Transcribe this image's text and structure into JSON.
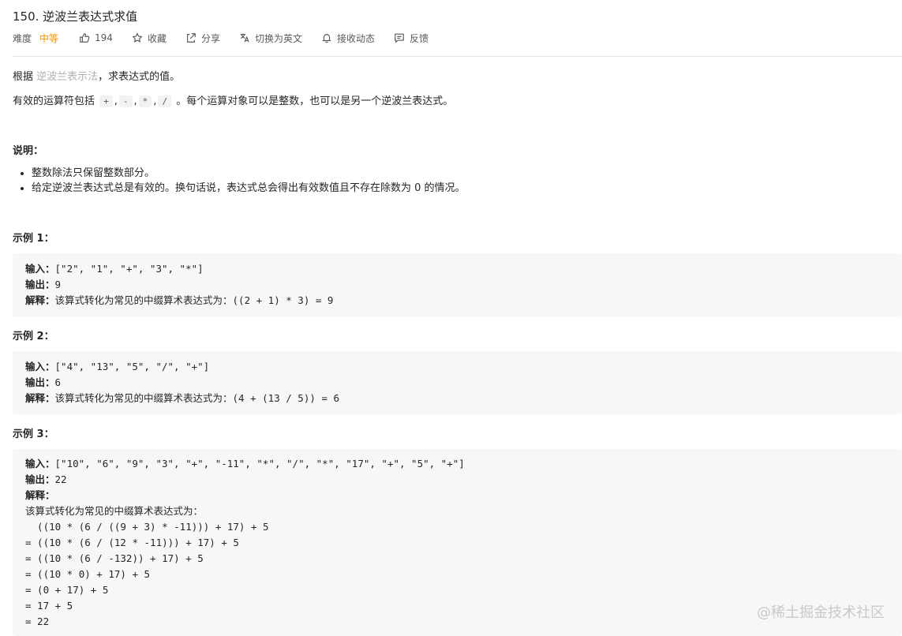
{
  "problem": {
    "title": "150. 逆波兰表达式求值"
  },
  "meta": {
    "difficulty_label": "难度",
    "difficulty": "中等",
    "likes": "194",
    "favorite": "收藏",
    "share": "分享",
    "switch_lang": "切换为英文",
    "notify": "接收动态",
    "feedback": "反馈"
  },
  "desc": {
    "p1_pre": "根据 ",
    "p1_link": "逆波兰表示法",
    "p1_post": "，求表达式的值。",
    "p2_pre": "有效的运算符包括 ",
    "ops": [
      "+",
      "-",
      "*",
      "/"
    ],
    "p2_post": "。每个运算对象可以是整数，也可以是另一个逆波兰表达式。"
  },
  "notes": {
    "heading": "说明：",
    "items": [
      "整数除法只保留整数部分。",
      "给定逆波兰表达式总是有效的。换句话说，表达式总会得出有效数值且不存在除数为 0 的情况。"
    ]
  },
  "examples": [
    {
      "heading": "示例 1：",
      "input_label": "输入：",
      "input": "[\"2\", \"1\", \"+\", \"3\", \"*\"]",
      "output_label": "输出：",
      "output": "9",
      "explain_label": "解释：",
      "explain": "该算式转化为常见的中缀算术表达式为：((2 + 1) * 3) = 9"
    },
    {
      "heading": "示例 2：",
      "input_label": "输入：",
      "input": "[\"4\", \"13\", \"5\", \"/\", \"+\"]",
      "output_label": "输出：",
      "output": "6",
      "explain_label": "解释：",
      "explain": "该算式转化为常见的中缀算术表达式为：(4 + (13 / 5)) = 6"
    },
    {
      "heading": "示例 3：",
      "input_label": "输入：",
      "input": "[\"10\", \"6\", \"9\", \"3\", \"+\", \"-11\", \"*\", \"/\", \"*\", \"17\", \"+\", \"5\", \"+\"]",
      "output_label": "输出：",
      "output": "22",
      "explain_label": "解释：",
      "explain_lines": [
        "该算式转化为常见的中缀算术表达式为：",
        "  ((10 * (6 / ((9 + 3) * -11))) + 17) + 5",
        "= ((10 * (6 / (12 * -11))) + 17) + 5",
        "= ((10 * (6 / -132)) + 17) + 5",
        "= ((10 * 0) + 17) + 5",
        "= (0 + 17) + 5",
        "= 17 + 5",
        "= 22"
      ]
    }
  ],
  "watermark": "@稀土掘金技术社区",
  "colors": {
    "difficulty": "#ff9100",
    "link": "#b0b0b0",
    "code_bg": "#f7f7f7"
  }
}
